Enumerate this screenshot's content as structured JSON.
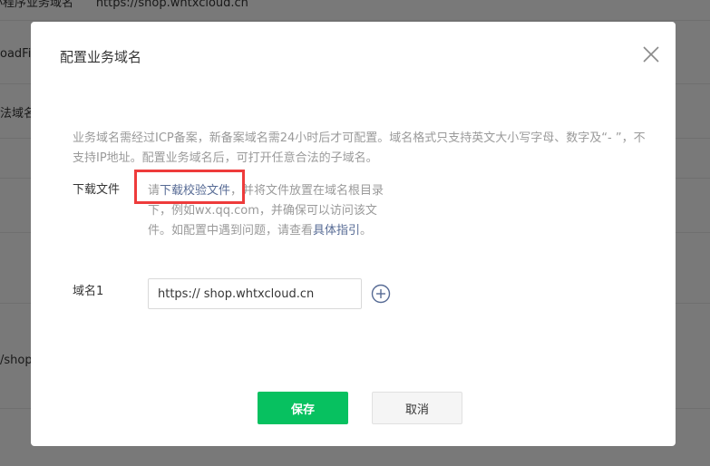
{
  "background": {
    "texts": [
      "小程序业务域名",
      "https://shop.whtxcloud.cn",
      "oadFi",
      "法域名",
      "/shop"
    ]
  },
  "dialog": {
    "title": "配置业务域名",
    "description": "业务域名需经过ICP备案，新备案域名需24小时后才可配置。域名格式只支持英文大小写字母、数字及“- ”，不支持IP地址。配置业务域名后，可打开任意合法的子域名。",
    "download": {
      "label": "下载文件",
      "prefix": "请",
      "link_text": "下载校验文件",
      "middle_text": "，并将文件放置在域名根目录下，例如wx.qq.com，并确保可以访问该文件。如配置中遇到问题，请查看",
      "guide_link_text": "具体指引",
      "suffix": "。"
    },
    "domain": {
      "label": "域名1",
      "value": "https:// shop.whtxcloud.cn"
    },
    "buttons": {
      "save": "保存",
      "cancel": "取消"
    }
  },
  "colors": {
    "primary": "#07c160",
    "link": "#576b95",
    "highlight": "#ee3b3b",
    "muted_text": "#9a9a9a"
  }
}
